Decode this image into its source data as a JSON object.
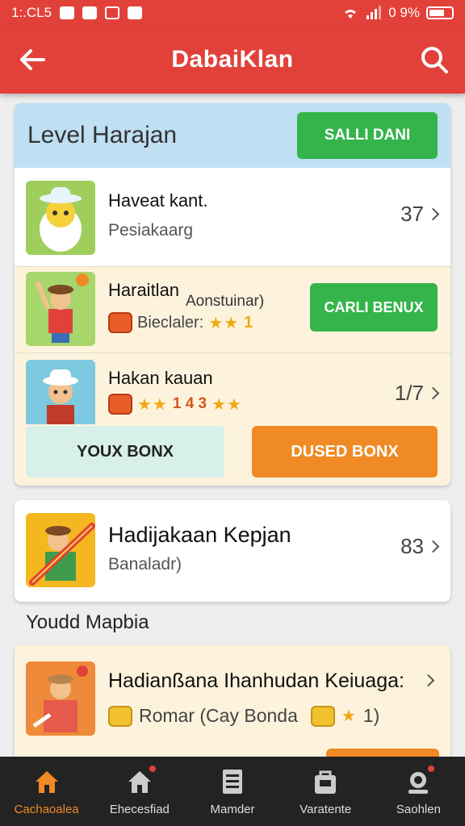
{
  "status_bar": {
    "time": "1:.CL5",
    "battery": "0 9%"
  },
  "app_bar": {
    "title": "DabaiKlan"
  },
  "level_card": {
    "title": "Level Harajan",
    "header_button": "SALLI DANI",
    "rows": [
      {
        "title": "Haveat kant.",
        "subtitle": "Pesiakaarg",
        "count": "37"
      },
      {
        "title": "Haraitlan",
        "note": "Aonstuinar)",
        "subtitle": "Bieclaler:",
        "reward": "1",
        "button": "CARLI BENUX"
      },
      {
        "title": "Hakan kauan",
        "subtitle": "1 4 3",
        "count": "1/7"
      }
    ],
    "left_button": "YOUX BONX",
    "right_button": "DUSED BONX"
  },
  "single_card": {
    "title": "Hadijakaan Kepjan",
    "subtitle": "Banaladr)",
    "count": "83"
  },
  "section_label": "Youdd Mapbia",
  "lower_card": {
    "title": "Hadianßana Ihanhudan Keiuaga:",
    "subtitle": "Romar (Cay Bonda",
    "badge": "1)"
  },
  "bottom_nav": [
    {
      "label": "Cachaoalea",
      "icon": "home-icon"
    },
    {
      "label": "Ehecesfiad",
      "icon": "home-outline-icon"
    },
    {
      "label": "Mamder",
      "icon": "document-icon"
    },
    {
      "label": "Varatente",
      "icon": "bag-icon"
    },
    {
      "label": "Saohlen",
      "icon": "profile-icon"
    }
  ],
  "colors": {
    "primary": "#e2413a",
    "green": "#34b44a",
    "orange": "#f08a24",
    "stars": "#f2a714"
  }
}
